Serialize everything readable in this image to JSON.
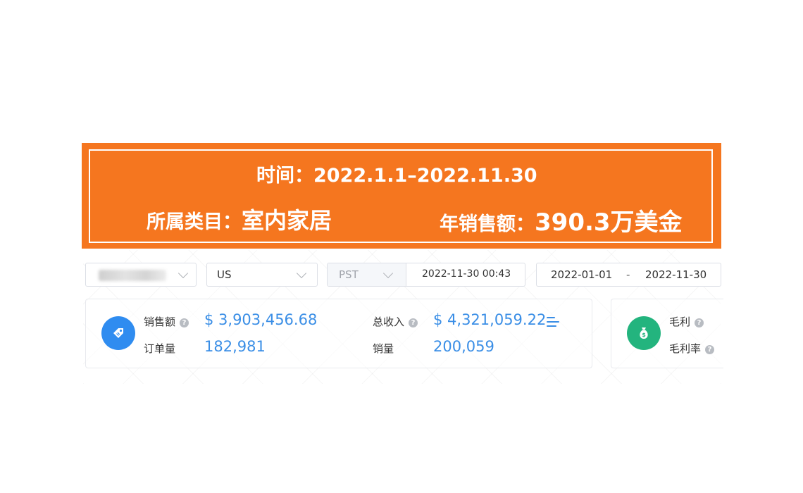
{
  "banner": {
    "time_label": "时间：",
    "time_value": "2022.1.1–2022.11.30",
    "category_label": "所属类目：",
    "category_value": "室内家居",
    "annual_sales_label": "年销售额：",
    "annual_sales_value": "390.3万美金",
    "background_color": "#f5761f"
  },
  "filters": {
    "country": "US",
    "timezone": "PST",
    "current_time": "2022-11-30 00:43",
    "date_start": "2022-01-01",
    "date_separator": "-",
    "date_end": "2022-11-30"
  },
  "sales_card": {
    "icon": "tag-icon",
    "sales_label": "销售额",
    "sales_value": "$ 3,903,456.68",
    "orders_label": "订单量",
    "orders_value": "182,981",
    "revenue_label": "总收入",
    "revenue_value": "$ 4,321,059.22",
    "units_label": "销量",
    "units_value": "200,059",
    "accent_color": "#3a8ee6"
  },
  "profit_card": {
    "icon": "money-bag-icon",
    "gross_profit_label": "毛利",
    "gross_margin_label": "毛利率",
    "accent_color": "#23b47e"
  }
}
